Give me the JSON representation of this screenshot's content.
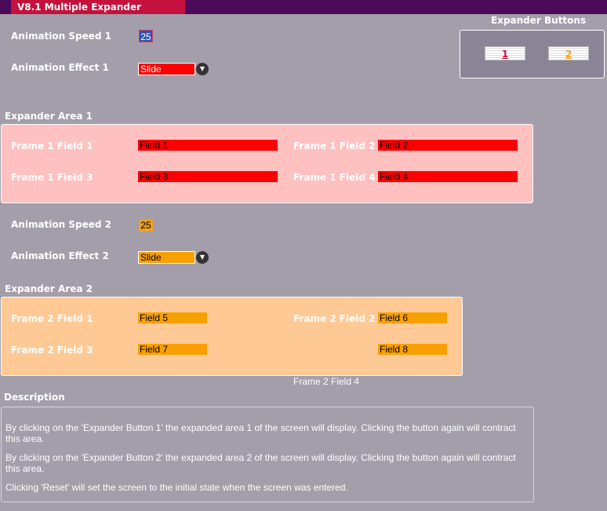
{
  "header": {
    "tab_label": "V8.1 Multiple Expander"
  },
  "controls1": {
    "speed_label": "Animation Speed 1",
    "speed_value": "25",
    "effect_label": "Animation Effect 1",
    "effect_value": "Slide"
  },
  "expander_buttons": {
    "title": "Expander Buttons",
    "button1_label": "1",
    "button2_label": "2"
  },
  "area1": {
    "title": "Expander Area 1",
    "fields": [
      {
        "label": "Frame 1 Field 1",
        "value": "Field 1"
      },
      {
        "label": "Frame 1 Field 2",
        "value": "Field 2"
      },
      {
        "label": "Frame 1 Field 3",
        "value": "Field 3"
      },
      {
        "label": "Frame 1 Field 4",
        "value": "Field 4"
      }
    ]
  },
  "controls2": {
    "speed_label": "Animation Speed 2",
    "speed_value": "25",
    "effect_label": "Animation Effect 2",
    "effect_value": "Slide"
  },
  "area2": {
    "title": "Expander Area 2",
    "fields": [
      {
        "label": "Frame 2 Field 1",
        "value": "Field 5"
      },
      {
        "label": "Frame 2 Field 2",
        "value": "Field 6"
      },
      {
        "label": "Frame 2 Field 3",
        "value": "Field 7"
      },
      {
        "label": "Frame 2 Field 4",
        "value": "Field 8"
      }
    ]
  },
  "description": {
    "title": "Description",
    "paragraphs": [
      "By clicking on the 'Expander Button 1' the expanded area 1 of the screen will display. Clicking the button again will contract this area.",
      "By clicking on the 'Expander Button 2' the expanded area 2 of the screen will display. Clicking the button again will contract this area.",
      "Clicking 'Reset' will set the screen to the initial state when the screen was entered."
    ]
  },
  "colors": {
    "top_bar": "#4c0a5a",
    "tab": "#c4113d",
    "background": "#a39ea9",
    "area1_bg": "#ffc0c0",
    "area1_field": "#ff0000",
    "area2_bg": "#ffc996",
    "area2_field": "#f8a000"
  },
  "icons": {
    "dropdown": "chevron-down-icon"
  }
}
